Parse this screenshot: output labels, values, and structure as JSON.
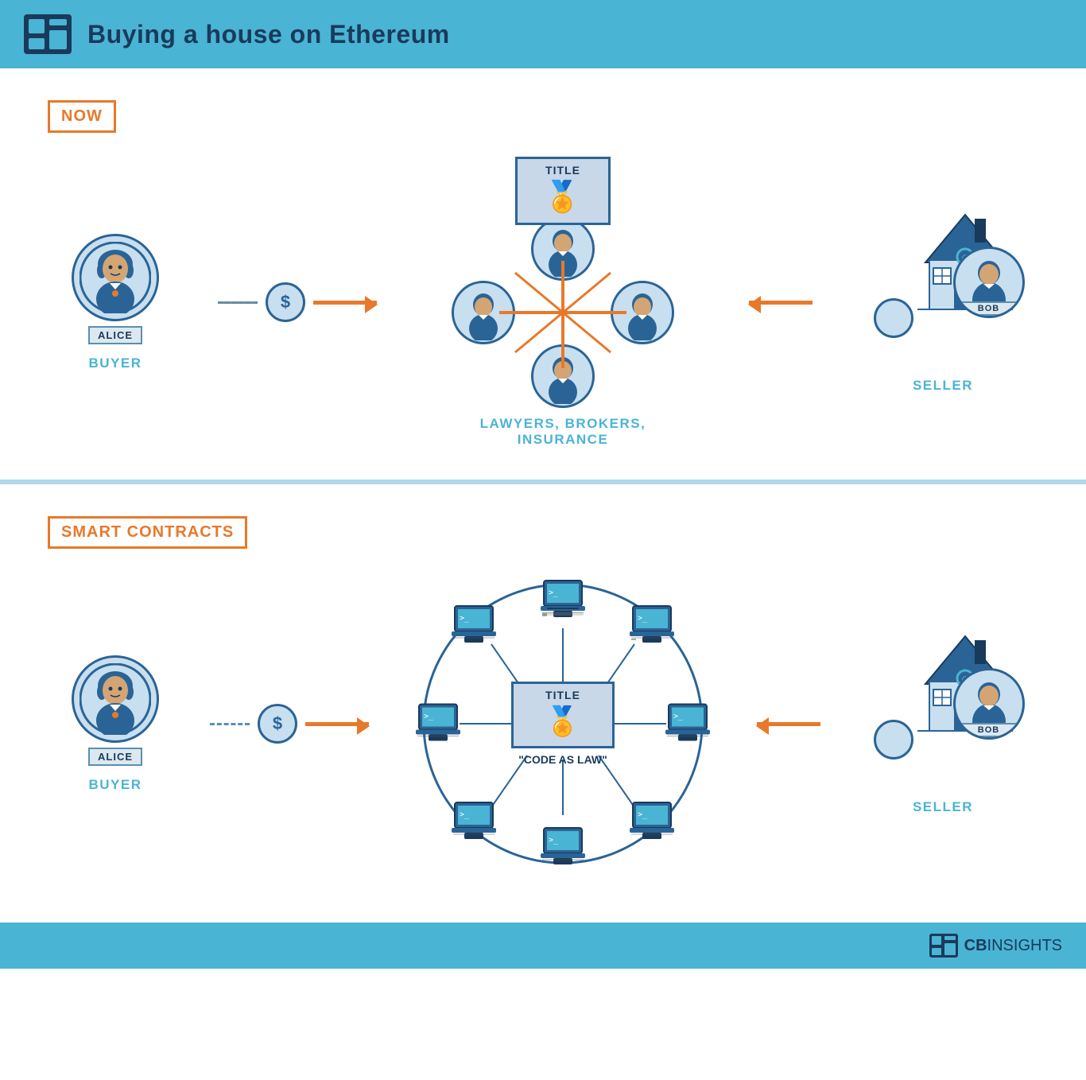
{
  "header": {
    "title": "Buying a house on Ethereum",
    "logo_alt": "CB Insights logo"
  },
  "section_now": {
    "badge": "NOW",
    "buyer_name": "ALICE",
    "buyer_label": "BUYER",
    "seller_name": "BOB",
    "seller_label": "SELLER",
    "center_label": "LAWYERS, BROKERS,\nINSURANCE",
    "title_text": "TITLE",
    "dollar_symbol": "$"
  },
  "section_smart": {
    "badge": "SMART CONTRACTS",
    "buyer_name": "ALICE",
    "buyer_label": "BUYER",
    "seller_name": "BOB",
    "seller_label": "SELLER",
    "title_text": "TITLE",
    "code_law": "\"CODE AS LAW\"",
    "dollar_symbol": "$"
  },
  "footer": {
    "brand_bold": "CB",
    "brand_light": "INSIGHTS"
  },
  "colors": {
    "blue_dark": "#1a3a5c",
    "blue_mid": "#2a6496",
    "blue_light": "#4ab4d4",
    "blue_pale": "#c8dff0",
    "orange": "#e8792a",
    "gray_bg": "#c8d8e8"
  }
}
